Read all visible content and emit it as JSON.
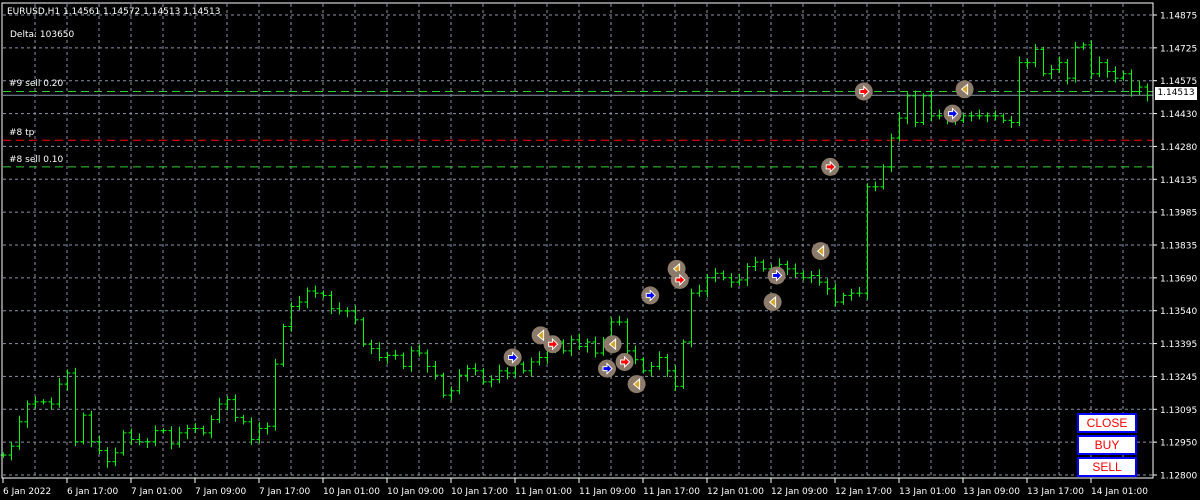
{
  "header": {
    "symbol_line": "EURUSD,H1  1.14561 1.14572 1.14513 1.14513",
    "delta": "Delta: 103650"
  },
  "order_lines": [
    {
      "label": "#9 sell 0.20",
      "price": 1.1453,
      "color": "#32cd32",
      "style": "dash"
    },
    {
      "label": "#8 tp",
      "price": 1.1431,
      "color": "#ff0000",
      "style": "dash"
    },
    {
      "label": "#8 sell 0.10",
      "price": 1.1419,
      "color": "#32cd32",
      "style": "dash"
    }
  ],
  "current_price": {
    "value": "1.14513",
    "price": 1.14513
  },
  "buttons": {
    "close": "CLOSE",
    "buy": "BUY",
    "sell": "SELL"
  },
  "colors": {
    "bars": "#00ff00",
    "grid": "#8a94a6",
    "buy": "#0000ff",
    "sell": "#ff0000",
    "close_marker": "#daa520"
  },
  "chart_data": {
    "type": "ohlc-bar",
    "symbol": "EURUSD",
    "timeframe": "H1",
    "ylim": [
      1.128,
      1.14875
    ],
    "price_ticks": [
      "1.14875",
      "1.14725",
      "1.14575",
      "1.14430",
      "1.14280",
      "1.14135",
      "1.13985",
      "1.13835",
      "1.13690",
      "1.13540",
      "1.13395",
      "1.13245",
      "1.13095",
      "1.12950",
      "1.12800"
    ],
    "time_ticks": [
      "6 Jan 2022",
      "6 Jan 17:00",
      "7 Jan 01:00",
      "7 Jan 09:00",
      "7 Jan 17:00",
      "10 Jan 01:00",
      "10 Jan 09:00",
      "10 Jan 17:00",
      "11 Jan 01:00",
      "11 Jan 09:00",
      "11 Jan 17:00",
      "12 Jan 01:00",
      "12 Jan 09:00",
      "12 Jan 17:00",
      "13 Jan 01:00",
      "13 Jan 09:00",
      "13 Jan 17:00",
      "14 Jan 01:00"
    ],
    "closes": [
      1.1289,
      1.1293,
      1.1304,
      1.1312,
      1.1313,
      1.1313,
      1.1312,
      1.1321,
      1.1326,
      1.1295,
      1.1307,
      1.1295,
      1.1291,
      1.1286,
      1.129,
      1.1299,
      1.1296,
      1.1295,
      1.1295,
      1.13,
      1.13,
      1.1294,
      1.1299,
      1.1301,
      1.1301,
      1.1299,
      1.1305,
      1.1312,
      1.1314,
      1.1306,
      1.1304,
      1.1296,
      1.1301,
      1.1302,
      1.133,
      1.1347,
      1.1356,
      1.1358,
      1.1363,
      1.1362,
      1.1361,
      1.1355,
      1.1354,
      1.1354,
      1.135,
      1.1339,
      1.1337,
      1.1333,
      1.1334,
      1.1334,
      1.1329,
      1.1336,
      1.1335,
      1.1329,
      1.1325,
      1.1316,
      1.1318,
      1.1325,
      1.1328,
      1.1327,
      1.1322,
      1.1323,
      1.1327,
      1.1326,
      1.133,
      1.1327,
      1.1331,
      1.1333,
      1.1337,
      1.134,
      1.1336,
      1.1341,
      1.1338,
      1.134,
      1.1335,
      1.1341,
      1.1349,
      1.1349,
      1.1336,
      1.1332,
      1.1327,
      1.1329,
      1.1333,
      1.1327,
      1.132,
      1.134,
      1.1362,
      1.1363,
      1.1369,
      1.1371,
      1.1369,
      1.1367,
      1.1368,
      1.1374,
      1.1376,
      1.1373,
      1.1372,
      1.1375,
      1.1373,
      1.1371,
      1.1369,
      1.137,
      1.1367,
      1.1364,
      1.1358,
      1.1361,
      1.1362,
      1.1362,
      1.141,
      1.141,
      1.1419,
      1.1432,
      1.1441,
      1.1451,
      1.1439,
      1.1451,
      1.1442,
      1.1442,
      1.1441,
      1.144,
      1.1442,
      1.1442,
      1.1442,
      1.1442,
      1.1442,
      1.144,
      1.1439,
      1.1466,
      1.1466,
      1.1472,
      1.1461,
      1.1463,
      1.1466,
      1.1459,
      1.1473,
      1.1474,
      1.1461,
      1.1466,
      1.1462,
      1.1459,
      1.1461,
      1.1453,
      1.1455,
      1.14513
    ],
    "trades": [
      {
        "kind": "buy",
        "bar": 63.7,
        "price": 1.1333
      },
      {
        "kind": "close",
        "bar": 67.2,
        "price": 1.1343
      },
      {
        "kind": "sell",
        "bar": 68.7,
        "price": 1.1339
      },
      {
        "kind": "buy",
        "bar": 75.5,
        "price": 1.1328
      },
      {
        "kind": "close",
        "bar": 76.2,
        "price": 1.1339
      },
      {
        "kind": "sell",
        "bar": 77.7,
        "price": 1.1331
      },
      {
        "kind": "close",
        "bar": 79.2,
        "price": 1.1321
      },
      {
        "kind": "buy",
        "bar": 80.9,
        "price": 1.1361
      },
      {
        "kind": "close",
        "bar": 84.2,
        "price": 1.1373
      },
      {
        "kind": "sell",
        "bar": 84.6,
        "price": 1.1368
      },
      {
        "kind": "close",
        "bar": 96.2,
        "price": 1.1358
      },
      {
        "kind": "buy",
        "bar": 96.7,
        "price": 1.137
      },
      {
        "kind": "close",
        "bar": 102.2,
        "price": 1.1381
      },
      {
        "kind": "sell",
        "bar": 103.4,
        "price": 1.1419
      },
      {
        "kind": "sell",
        "bar": 107.6,
        "price": 1.1453
      },
      {
        "kind": "buy",
        "bar": 118.7,
        "price": 1.1443
      },
      {
        "kind": "close",
        "bar": 120.2,
        "price": 1.1454
      }
    ]
  }
}
